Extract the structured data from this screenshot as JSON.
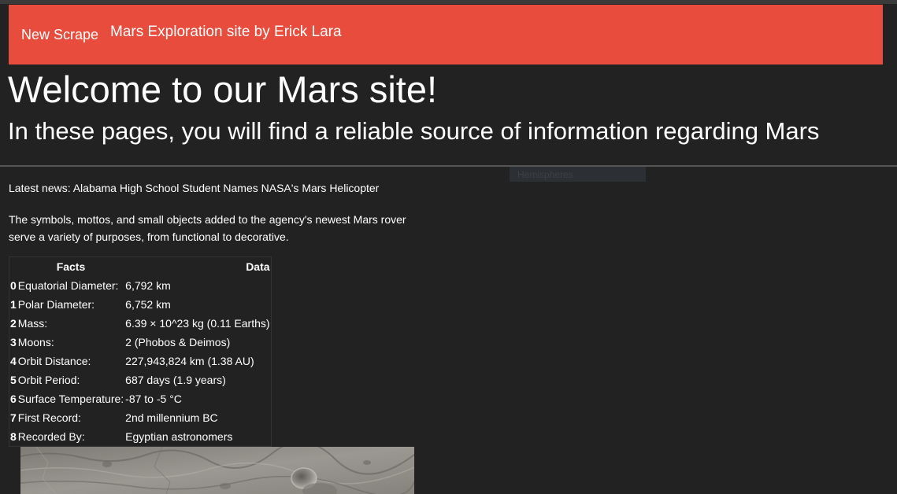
{
  "navbar": {
    "new_scrape_label": "New Scrape",
    "brand_label": "Mars Exploration site by Erick Lara",
    "background_color": "#e74c3c"
  },
  "jumbotron": {
    "title": "Welcome to our Mars site!",
    "subtitle": "In these pages, you will find a reliable source of information regarding Mars"
  },
  "hidden_button_label": "Hemispheres",
  "news": {
    "title": "Latest news: Alabama High School Student Names NASA's Mars Helicopter",
    "paragraph": "The symbols, mottos, and small objects added to the agency's newest Mars rover serve a variety of purposes, from functional to decorative."
  },
  "facts_table": {
    "headers": [
      "Facts",
      "Data"
    ],
    "rows": [
      {
        "index": "0",
        "fact": "Equatorial Diameter:",
        "value": "6,792 km"
      },
      {
        "index": "1",
        "fact": "Polar Diameter:",
        "value": "6,752 km"
      },
      {
        "index": "2",
        "fact": "Mass:",
        "value": "6.39 × 10^23 kg (0.11 Earths)"
      },
      {
        "index": "3",
        "fact": "Moons:",
        "value": "2 (Phobos & Deimos)"
      },
      {
        "index": "4",
        "fact": "Orbit Distance:",
        "value": "227,943,824 km (1.38 AU)"
      },
      {
        "index": "5",
        "fact": "Orbit Period:",
        "value": "687 days (1.9 years)"
      },
      {
        "index": "6",
        "fact": "Surface Temperature:",
        "value": "-87 to -5 °C"
      },
      {
        "index": "7",
        "fact": "First Record:",
        "value": "2nd millennium BC"
      },
      {
        "index": "8",
        "fact": "Recorded By:",
        "value": "Egyptian astronomers"
      }
    ]
  },
  "featured_image": {
    "icon": "mars-surface-image"
  }
}
